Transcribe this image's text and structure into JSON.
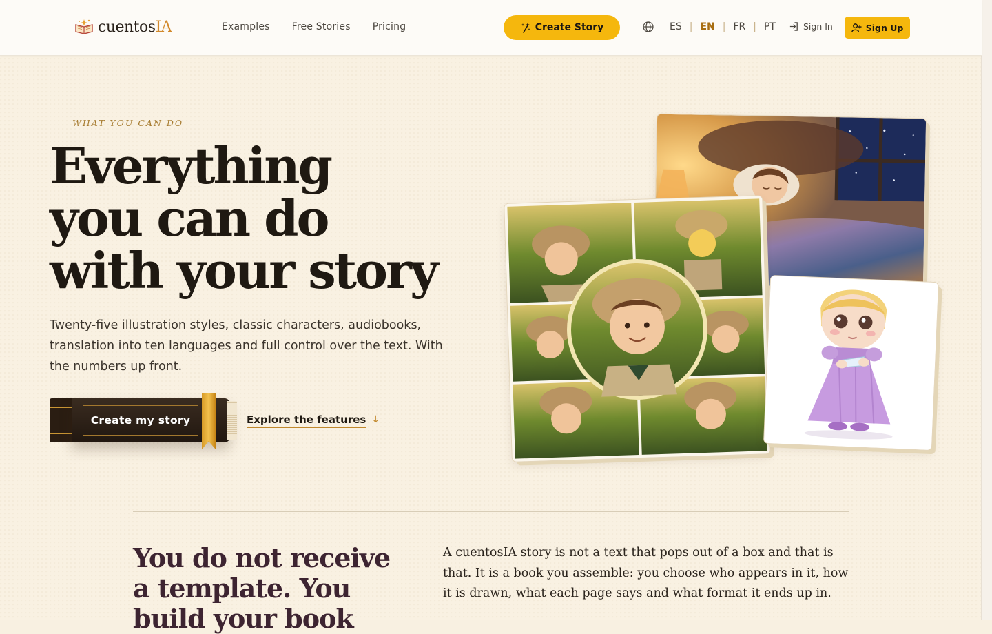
{
  "header": {
    "logo": {
      "main": "cuentos",
      "accent": "IA"
    },
    "nav": [
      "Examples",
      "Free Stories",
      "Pricing"
    ],
    "create_story": "Create Story",
    "languages": [
      {
        "code": "ES",
        "active": false
      },
      {
        "code": "EN",
        "active": true
      },
      {
        "code": "FR",
        "active": false
      },
      {
        "code": "PT",
        "active": false
      }
    ],
    "sign_in": "Sign In",
    "sign_up": "Sign Up"
  },
  "hero": {
    "eyebrow": "WHAT YOU CAN DO",
    "title_lines": [
      "Everything",
      "you can do",
      "with your story"
    ],
    "subtitle": "Twenty-five illustration styles, classic characters, audiobooks, translation into ten languages and full control over the text. With the numbers up front.",
    "primary_cta": "Create my story",
    "secondary_cta": "Explore the features",
    "secondary_arrow": "↓"
  },
  "section": {
    "title": "You do not receive a template. You build your book",
    "text": "A cuentosIA story is not a text that pops out of a box and that is that. It is a book you assemble: you choose who appears in it, how it is drawn, what each page says and what format it ends up in."
  },
  "colors": {
    "accent": "#f5b70d",
    "background": "#f9f1e2",
    "header_bg": "#fdfbf7",
    "eyebrow": "#a67b2f",
    "section_title": "#3d2431"
  },
  "icons": [
    "book-logo-icon",
    "sparkle-icon",
    "globe-icon",
    "sign-in-icon",
    "user-plus-icon",
    "arrow-down-icon"
  ]
}
